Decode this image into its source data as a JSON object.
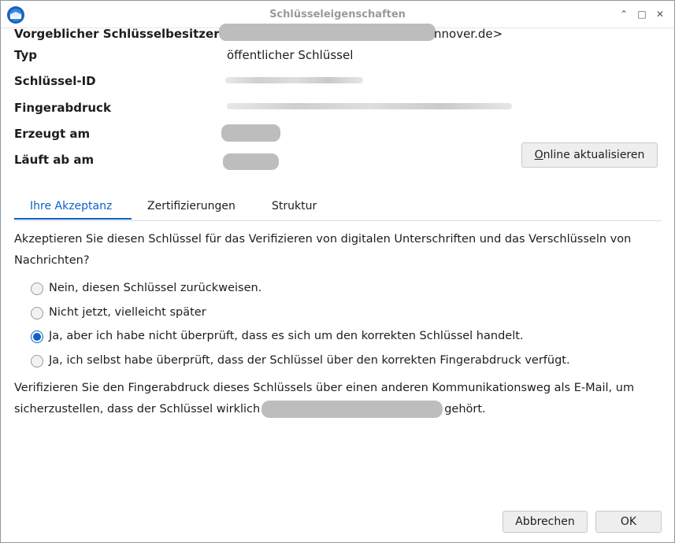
{
  "window": {
    "title": "Schlüsseleigenschaften",
    "minimize_glyph": "⌃",
    "maximize_glyph": "□",
    "close_glyph": "✕"
  },
  "properties": {
    "owner_label": "Vorgeblicher Schlüsselbesitzer",
    "owner_value_suffix": "nnover.de>",
    "type_label": "Typ",
    "type_value": "öffentlicher Schlüssel",
    "keyid_label": "Schlüssel-ID",
    "fingerprint_label": "Fingerabdruck",
    "created_label": "Erzeugt am",
    "expires_label": "Läuft ab am"
  },
  "buttons": {
    "online_update_accel": "O",
    "online_update_rest": "nline aktualisieren",
    "cancel": "Abbrechen",
    "ok": "OK"
  },
  "tabs": [
    {
      "label": "Ihre Akzeptanz",
      "active": true
    },
    {
      "label": "Zertifizierungen",
      "active": false
    },
    {
      "label": "Struktur",
      "active": false
    }
  ],
  "acceptance": {
    "question": "Akzeptieren Sie diesen Schlüssel für das Verifizieren von digitalen Unterschriften und das Verschlüsseln von Nachrichten?",
    "options": [
      {
        "label": "Nein, diesen Schlüssel zurückweisen.",
        "checked": false
      },
      {
        "label": "Nicht jetzt, vielleicht später",
        "checked": false
      },
      {
        "label": "Ja, aber ich habe nicht überprüft, dass es sich um den korrekten Schlüssel handelt.",
        "checked": true
      },
      {
        "label": "Ja, ich selbst habe überprüft, dass der Schlüssel über den korrekten Fingerabdruck verfügt.",
        "checked": false
      }
    ],
    "verify_text_before": "Verifizieren Sie den Fingerabdruck dieses Schlüssels über einen anderen Kommunikationsweg als E-Mail, um sicherzustellen, dass der Schlüssel wirklich",
    "verify_text_after": "gehört."
  },
  "colors": {
    "accent": "#0a62c9",
    "title_text": "#9a9a9a",
    "redaction": "#bdbdbd"
  },
  "icons": {
    "app": "thunderbird-icon"
  }
}
